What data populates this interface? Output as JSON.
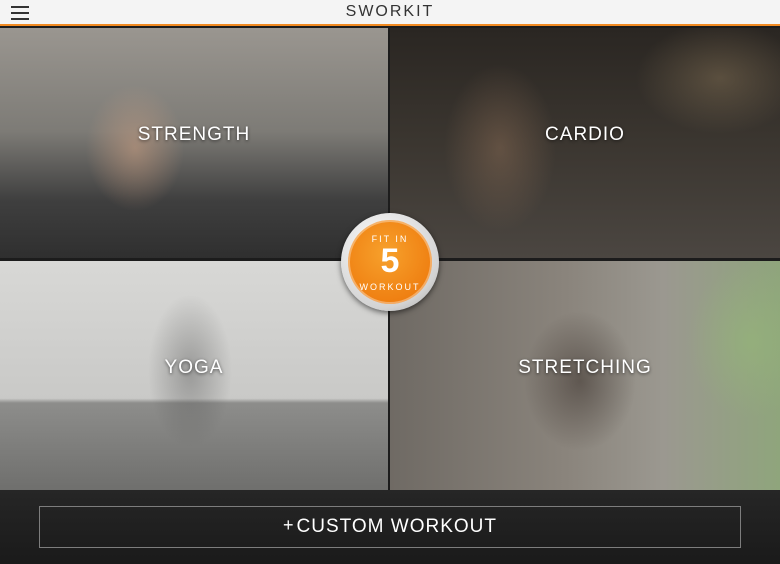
{
  "header": {
    "menu_icon": "hamburger-icon",
    "brand": "SWORKIT",
    "accent_color": "#f18a21"
  },
  "tiles": [
    {
      "id": "strength",
      "label": "STRENGTH"
    },
    {
      "id": "cardio",
      "label": "CARDIO"
    },
    {
      "id": "yoga",
      "label": "YOGA"
    },
    {
      "id": "stretching",
      "label": "STRETCHING"
    }
  ],
  "fit_in_5": {
    "top_text": "FIT IN",
    "number": "5",
    "bottom_text": "WORKOUT",
    "color": "#ee7b0e"
  },
  "footer": {
    "plus_icon": "plus-icon",
    "plus_glyph": "+",
    "custom_workout_label": "CUSTOM WORKOUT"
  }
}
